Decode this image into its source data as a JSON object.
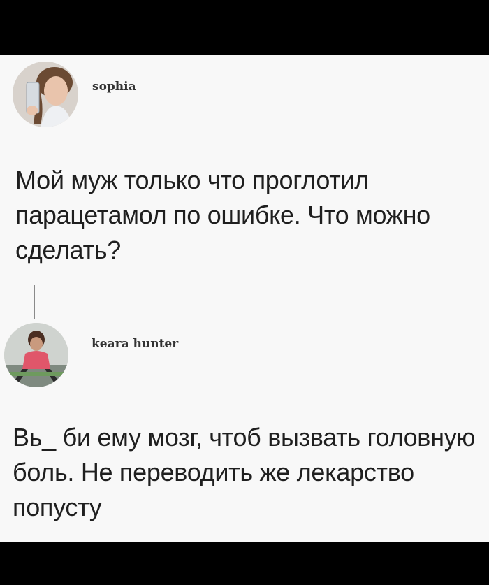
{
  "posts": [
    {
      "username": "sophia",
      "text": "Мой муж только что проглотил парацетамол по ошибке. Что можно сделать?",
      "avatar_icon": "user-photo-selfie"
    },
    {
      "username": "keara hunter",
      "text": "Вь_ би ему мозг, чтоб вызвать головную боль. Не переводить же лекарство попусту",
      "avatar_icon": "user-photo-workout"
    }
  ],
  "colors": {
    "background": "#f8f8f8",
    "frame": "#000000",
    "text": "#1f1f1f",
    "thread_line": "#8a8a8a"
  }
}
